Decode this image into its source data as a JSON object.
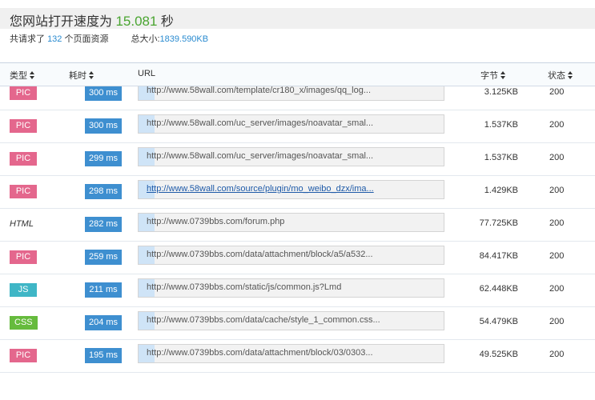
{
  "header": {
    "title_prefix": "您网站打开速度为",
    "speed": "15.081",
    "title_suffix": "秒",
    "summary_prefix": "共请求了",
    "request_count": "132",
    "summary_mid": "个页面资源",
    "total_size_label": "总大小:",
    "total_size": "1839.590KB"
  },
  "table": {
    "columns": {
      "type": "类型",
      "time": "耗时",
      "url": "URL",
      "bytes": "字节",
      "status": "状态"
    },
    "rows": [
      {
        "type": "PIC",
        "type_class": "pic",
        "time": "300 ms",
        "url": "http://www.58wall.com/template/cr180_x/images/qq_log...",
        "bytes": "3.125KB",
        "status": "200"
      },
      {
        "type": "PIC",
        "type_class": "pic",
        "time": "300 ms",
        "url": "http://www.58wall.com/uc_server/images/noavatar_smal...",
        "bytes": "1.537KB",
        "status": "200"
      },
      {
        "type": "PIC",
        "type_class": "pic",
        "time": "299 ms",
        "url": "http://www.58wall.com/uc_server/images/noavatar_smal...",
        "bytes": "1.537KB",
        "status": "200"
      },
      {
        "type": "PIC",
        "type_class": "pic",
        "time": "298 ms",
        "url": "http://www.58wall.com/source/plugin/mo_weibo_dzx/ima...",
        "bytes": "1.429KB",
        "status": "200"
      },
      {
        "type": "HTML",
        "type_class": "html",
        "time": "282 ms",
        "url": "http://www.0739bbs.com/forum.php",
        "bytes": "77.725KB",
        "status": "200"
      },
      {
        "type": "PIC",
        "type_class": "pic",
        "time": "259 ms",
        "url": "http://www.0739bbs.com/data/attachment/block/a5/a532...",
        "bytes": "84.417KB",
        "status": "200"
      },
      {
        "type": "JS",
        "type_class": "js",
        "time": "211 ms",
        "url": "http://www.0739bbs.com/static/js/common.js?Lmd",
        "bytes": "62.448KB",
        "status": "200"
      },
      {
        "type": "CSS",
        "type_class": "css",
        "time": "204 ms",
        "url": "http://www.0739bbs.com/data/cache/style_1_common.css...",
        "bytes": "54.479KB",
        "status": "200"
      },
      {
        "type": "PIC",
        "type_class": "pic",
        "time": "195 ms",
        "url": "http://www.0739bbs.com/data/attachment/block/03/0303...",
        "bytes": "49.525KB",
        "status": "200"
      }
    ]
  }
}
